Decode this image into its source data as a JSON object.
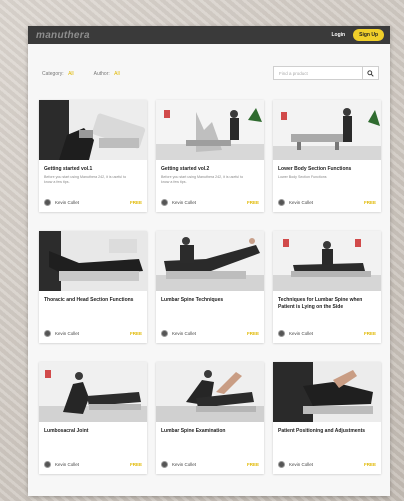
{
  "header": {
    "logo": "manuthera",
    "login_label": "Login",
    "signup_label": "Sign Up"
  },
  "filters": {
    "category_label": "Category:",
    "category_value": "All",
    "author_label": "Author:",
    "author_value": "All",
    "search_placeholder": "Find a product"
  },
  "products": [
    {
      "title": "Getting started vol.1",
      "desc": "Before you start using Manuthera 242, it is useful to know a few tips.",
      "author": "Kevin Collet",
      "price": "FREE"
    },
    {
      "title": "Getting started vol.2",
      "desc": "Before you start using Manuthera 242, it is useful to know a few tips.",
      "author": "Kevin Collet",
      "price": "FREE"
    },
    {
      "title": "Lower Body Section Functions",
      "desc": "Lower Body Section Functions",
      "author": "Kevin Collet",
      "price": "FREE"
    },
    {
      "title": "Thoracic and Head Section Functions",
      "desc": "",
      "author": "Kevin Collet",
      "price": "FREE"
    },
    {
      "title": "Lumbar Spine Techniques",
      "desc": "",
      "author": "Kevin Collet",
      "price": "FREE"
    },
    {
      "title": "Techniques for Lumbar Spine when Patient is Lying on the Side",
      "desc": "",
      "author": "Kevin Collet",
      "price": "FREE"
    },
    {
      "title": "Lumbosacral Joint",
      "desc": "",
      "author": "Kevin Collet",
      "price": "FREE"
    },
    {
      "title": "Lumbar Spine Examination",
      "desc": "",
      "author": "Kevin Collet",
      "price": "FREE"
    },
    {
      "title": "Patient Positioning and Adjustments",
      "desc": "",
      "author": "Kevin Collet",
      "price": "FREE"
    }
  ],
  "colors": {
    "accent": "#f0cf2a",
    "topbar": "#3a3a3a"
  }
}
